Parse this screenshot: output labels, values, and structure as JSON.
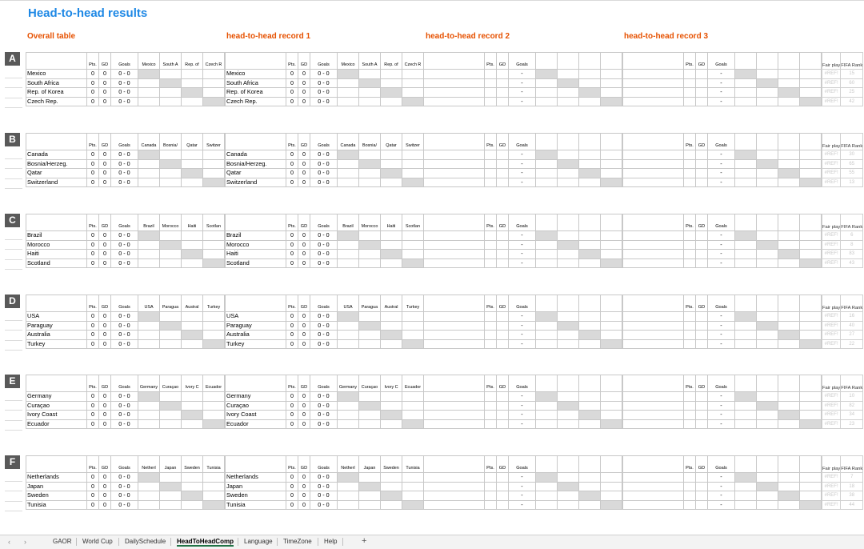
{
  "title": "Head-to-head results",
  "sections": [
    "Overall table",
    "head-to-head record 1",
    "head-to-head record 2",
    "head-to-head record 3"
  ],
  "headers": {
    "pts": "Pts.",
    "gd": "GD",
    "goals": "Goals",
    "fair": "Fair play",
    "fifa": "FIFA Rank"
  },
  "groups": [
    {
      "letter": "A",
      "opp": [
        "Mexico",
        "South A",
        "Rep. of",
        "Czech R"
      ],
      "teams": [
        {
          "name": "Mexico",
          "pts": "0",
          "gd": "0",
          "goals": "0 - 0",
          "rank": "15"
        },
        {
          "name": "South Africa",
          "pts": "0",
          "gd": "0",
          "goals": "0 - 0",
          "rank": "60"
        },
        {
          "name": "Rep. of Korea",
          "pts": "0",
          "gd": "0",
          "goals": "0 - 0",
          "rank": "25"
        },
        {
          "name": "Czech Rep.",
          "pts": "0",
          "gd": "0",
          "goals": "0 - 0",
          "rank": "42"
        }
      ]
    },
    {
      "letter": "B",
      "opp": [
        "Canada",
        "Bosnia/",
        "Qatar",
        "Switzer"
      ],
      "teams": [
        {
          "name": "Canada",
          "pts": "0",
          "gd": "0",
          "goals": "0 - 0",
          "rank": "30"
        },
        {
          "name": "Bosnia/Herzeg.",
          "pts": "0",
          "gd": "0",
          "goals": "0 - 0",
          "rank": "65"
        },
        {
          "name": "Qatar",
          "pts": "0",
          "gd": "0",
          "goals": "0 - 0",
          "rank": "55"
        },
        {
          "name": "Switzerland",
          "pts": "0",
          "gd": "0",
          "goals": "0 - 0",
          "rank": "13"
        }
      ]
    },
    {
      "letter": "C",
      "opp": [
        "Brazil",
        "Morocco",
        "Haiti",
        "Scotlan"
      ],
      "teams": [
        {
          "name": "Brazil",
          "pts": "0",
          "gd": "0",
          "goals": "0 - 0",
          "rank": "6"
        },
        {
          "name": "Morocco",
          "pts": "0",
          "gd": "0",
          "goals": "0 - 0",
          "rank": "8"
        },
        {
          "name": "Haiti",
          "pts": "0",
          "gd": "0",
          "goals": "0 - 0",
          "rank": "83"
        },
        {
          "name": "Scotland",
          "pts": "0",
          "gd": "0",
          "goals": "0 - 0",
          "rank": "43"
        }
      ]
    },
    {
      "letter": "D",
      "opp": [
        "USA",
        "Paragua",
        "Austral",
        "Turkey"
      ],
      "teams": [
        {
          "name": "USA",
          "pts": "0",
          "gd": "0",
          "goals": "0 - 0",
          "rank": "16"
        },
        {
          "name": "Paraguay",
          "pts": "0",
          "gd": "0",
          "goals": "0 - 0",
          "rank": "40"
        },
        {
          "name": "Australia",
          "pts": "0",
          "gd": "0",
          "goals": "0 - 0",
          "rank": "27"
        },
        {
          "name": "Turkey",
          "pts": "0",
          "gd": "0",
          "goals": "0 - 0",
          "rank": "22"
        }
      ]
    },
    {
      "letter": "E",
      "opp": [
        "Germany",
        "Curaçao",
        "Ivory C",
        "Ecuador"
      ],
      "teams": [
        {
          "name": "Germany",
          "pts": "0",
          "gd": "0",
          "goals": "0 - 0",
          "rank": "10"
        },
        {
          "name": "Curaçao",
          "pts": "0",
          "gd": "0",
          "goals": "0 - 0",
          "rank": "82"
        },
        {
          "name": "Ivory Coast",
          "pts": "0",
          "gd": "0",
          "goals": "0 - 0",
          "rank": "34"
        },
        {
          "name": "Ecuador",
          "pts": "0",
          "gd": "0",
          "goals": "0 - 0",
          "rank": "23"
        }
      ]
    },
    {
      "letter": "F",
      "opp": [
        "Netherl",
        "Japan",
        "Sweden",
        "Tunisia"
      ],
      "teams": [
        {
          "name": "Netherlands",
          "pts": "0",
          "gd": "0",
          "goals": "0 - 0",
          "rank": "7"
        },
        {
          "name": "Japan",
          "pts": "0",
          "gd": "0",
          "goals": "0 - 0",
          "rank": "18"
        },
        {
          "name": "Sweden",
          "pts": "0",
          "gd": "0",
          "goals": "0 - 0",
          "rank": "38"
        },
        {
          "name": "Tunisia",
          "pts": "0",
          "gd": "0",
          "goals": "0 - 0",
          "rank": "44"
        }
      ]
    }
  ],
  "empty_goals": "-",
  "fair_play_error": "#REF!",
  "sheet_tabs": [
    "GAOR",
    "World Cup",
    "DailySchedule",
    "HeadToHeadComp",
    "Language",
    "TimeZone",
    "Help"
  ],
  "active_tab": "HeadToHeadComp",
  "add_sheet": "+",
  "nav": {
    "prev": "‹",
    "next": "›"
  },
  "colors": {
    "title": "#1e88e5",
    "section": "#e65100",
    "group_badge": "#595959",
    "diag": "#d9d9d9"
  }
}
